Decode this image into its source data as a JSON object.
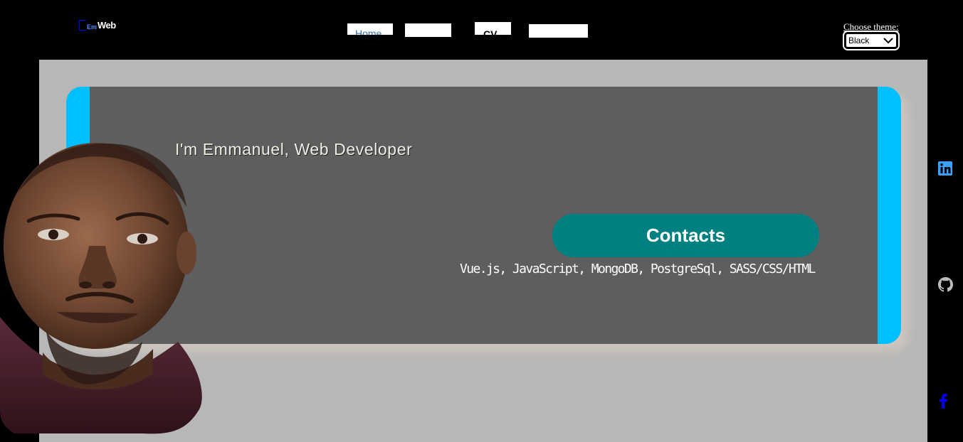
{
  "header": {
    "logo_prefix": "Em",
    "logo_text": "Web",
    "nav": [
      {
        "label": "Home"
      },
      {
        "label": ""
      },
      {
        "label": "CV"
      },
      {
        "label": ""
      }
    ],
    "theme_label": "Choose theme:",
    "theme_value": "Black",
    "theme_options": [
      "Black"
    ]
  },
  "hero": {
    "headline": "I'm Emmanuel, Web Developer",
    "contact_button": "Contacts",
    "skills": "Vue.js, JavaScript, MongoDB, PostgreSql, SASS/CSS/HTML"
  },
  "social": [
    {
      "icon": "linkedin-icon",
      "color": "#3aa0ff"
    },
    {
      "icon": "github-icon",
      "color": "#c0c0c0"
    },
    {
      "icon": "facebook-icon",
      "color": "#0000ff"
    }
  ],
  "colors": {
    "page_bg": "#000000",
    "main_bg": "#b7b7b7",
    "card_accent": "#00bfff",
    "card_bg": "#5e5e5e",
    "button_bg": "#008080"
  }
}
